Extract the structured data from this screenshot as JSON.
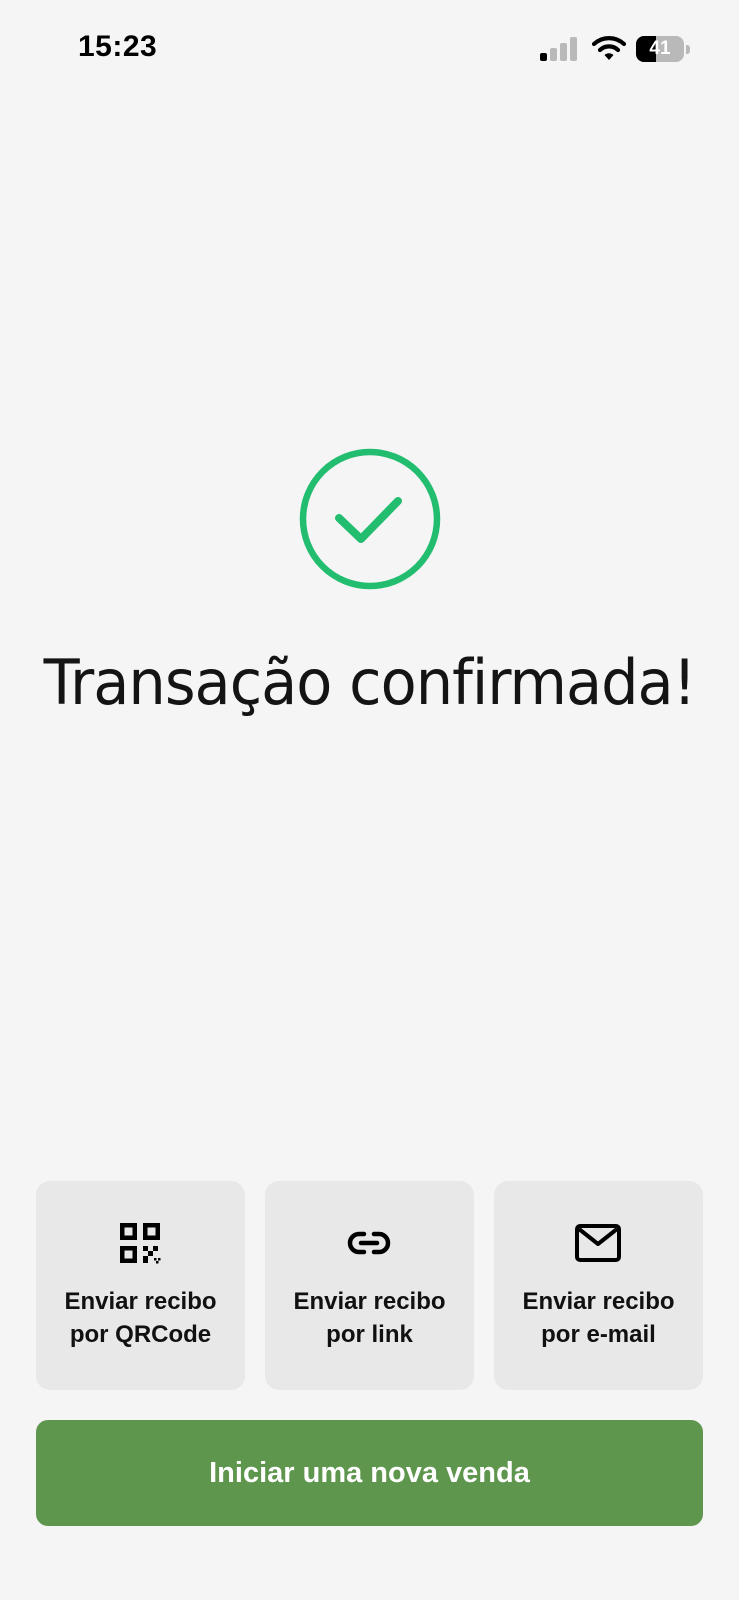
{
  "status_bar": {
    "time": "15:23",
    "battery_level": "41",
    "battery_fraction": 0.41,
    "signal_bars_active": 1,
    "signal_bars_total": 4
  },
  "main": {
    "title": "Transação confirmada!",
    "status_icon": "check-circle-icon",
    "accent_color": "#22bd6e"
  },
  "actions": [
    {
      "icon": "qr-code-icon",
      "line1": "Enviar recibo",
      "line2": "por QRCode"
    },
    {
      "icon": "link-icon",
      "line1": "Enviar recibo",
      "line2": "por link"
    },
    {
      "icon": "mail-icon",
      "line1": "Enviar recibo",
      "line2": "por e-mail"
    }
  ],
  "primary_button": {
    "label": "Iniciar uma nova venda",
    "color": "#5e964e"
  }
}
